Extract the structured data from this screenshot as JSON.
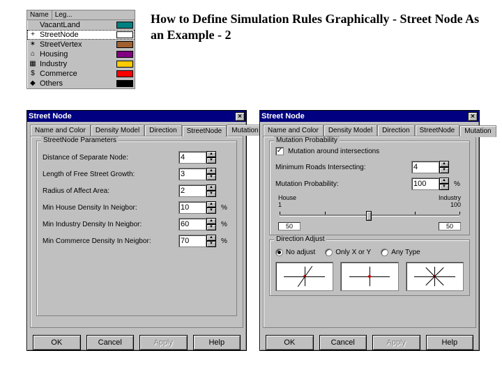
{
  "page_title": "How to Define Simulation Rules Graphically - Street Node As an Example - 2",
  "legend": {
    "header_name": "Name",
    "header_leg": "Leg...",
    "items": [
      {
        "icon": "",
        "label": "VacantLand",
        "color": "#008080"
      },
      {
        "icon": "+",
        "label": "StreetNode",
        "color": "#ffffff",
        "selected": true
      },
      {
        "icon": "✶",
        "label": "StreetVertex",
        "color": "#a06030"
      },
      {
        "icon": "⌂",
        "label": "Housing",
        "color": "#800080"
      },
      {
        "icon": "▦",
        "label": "Industry",
        "color": "#ffcc00"
      },
      {
        "icon": "$",
        "label": "Commerce",
        "color": "#ff0000"
      },
      {
        "icon": "◆",
        "label": "Others",
        "color": "#000000"
      }
    ]
  },
  "windows": {
    "left": {
      "title": "Street Node",
      "tabs": [
        "Name and Color",
        "Density Model",
        "Direction",
        "StreetNode",
        "Mutation"
      ],
      "active_tab": 3,
      "fieldset": "StreetNode Parameters",
      "params": [
        {
          "label": "Distance of Separate Node:",
          "value": "4"
        },
        {
          "label": "Length of Free Street Growth:",
          "value": "3"
        },
        {
          "label": "Radius of Affect Area:",
          "value": "2"
        },
        {
          "label": "Min House Density In Neigbor:",
          "value": "10",
          "suffix": "%"
        },
        {
          "label": "Min Industry Density In Neigbor:",
          "value": "60",
          "suffix": "%"
        },
        {
          "label": "Min Commerce Density In Neigbor:",
          "value": "70",
          "suffix": "%"
        }
      ]
    },
    "right": {
      "title": "Street Node",
      "tabs": [
        "Name and Color",
        "Density Model",
        "Direction",
        "StreetNode",
        "Mutation"
      ],
      "active_tab": 4,
      "fieldset_prob": "Mutation Probability",
      "checkbox_label": "Mutation around intersections",
      "checkbox_checked": true,
      "min_roads_label": "Minimum Roads Intersecting:",
      "min_roads_value": "4",
      "mut_prob_label": "Mutation Probability:",
      "mut_prob_value": "100",
      "mut_prob_suffix": "%",
      "slider_left": "House",
      "slider_right": "Industry",
      "slider_scale_min": "1",
      "slider_scale_max": "100",
      "slider_val_left": "50",
      "slider_val_right": "50",
      "fieldset_dir": "Direction Adjust",
      "radios": [
        {
          "label": "No adjust",
          "checked": true
        },
        {
          "label": "Only X or Y",
          "checked": false
        },
        {
          "label": "Any Type",
          "checked": false
        }
      ]
    }
  },
  "buttons": {
    "ok": "OK",
    "cancel": "Cancel",
    "apply": "Apply",
    "help": "Help"
  }
}
